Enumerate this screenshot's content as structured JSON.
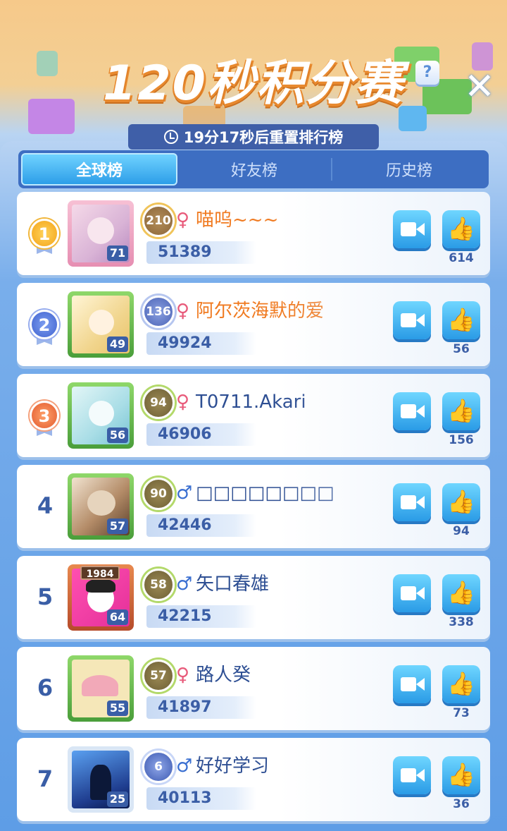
{
  "header": {
    "title": "120秒积分赛",
    "help_label": "?",
    "close_label": "✕",
    "timer_text": "19分17秒后重置排行榜"
  },
  "tabs": [
    {
      "label": "全球榜",
      "active": true
    },
    {
      "label": "好友榜",
      "active": false
    },
    {
      "label": "历史榜",
      "active": false
    }
  ],
  "colors": {
    "accent_blue": "#2a9be6",
    "name_orange": "#f07a20",
    "name_blue": "#2e4f93",
    "female": "#e85a7a",
    "male": "#3a6fd1"
  },
  "icons": {
    "video": "video-camera-icon",
    "like": "thumbs-up-icon",
    "clock": "clock-icon"
  },
  "leaderboard": [
    {
      "rank": "1",
      "medal": "gold",
      "level": "71",
      "vip": "210",
      "gender": "♀",
      "name": "喵呜~~~",
      "score": "51389",
      "likes": "614"
    },
    {
      "rank": "2",
      "medal": "silver",
      "level": "49",
      "vip": "136",
      "gender": "♀",
      "name": "阿尔茨海默的爱",
      "score": "49924",
      "likes": "56"
    },
    {
      "rank": "3",
      "medal": "bronze",
      "level": "56",
      "vip": "94",
      "gender": "♀",
      "name": "T0711.Akari",
      "score": "46906",
      "likes": "156"
    },
    {
      "rank": "4",
      "medal": "",
      "level": "57",
      "vip": "90",
      "gender": "♂",
      "name": "□□□□□□□□",
      "score": "42446",
      "likes": "94"
    },
    {
      "rank": "5",
      "medal": "",
      "level": "64",
      "vip": "58",
      "gender": "♂",
      "name": "矢口春雄",
      "score": "42215",
      "likes": "338",
      "frame_tag": "1984"
    },
    {
      "rank": "6",
      "medal": "",
      "level": "55",
      "vip": "57",
      "gender": "♀",
      "name": "路人癸",
      "score": "41897",
      "likes": "73"
    },
    {
      "rank": "7",
      "medal": "",
      "level": "25",
      "vip": "6",
      "gender": "♂",
      "name": "好好学习",
      "score": "40113",
      "likes": "36"
    }
  ]
}
